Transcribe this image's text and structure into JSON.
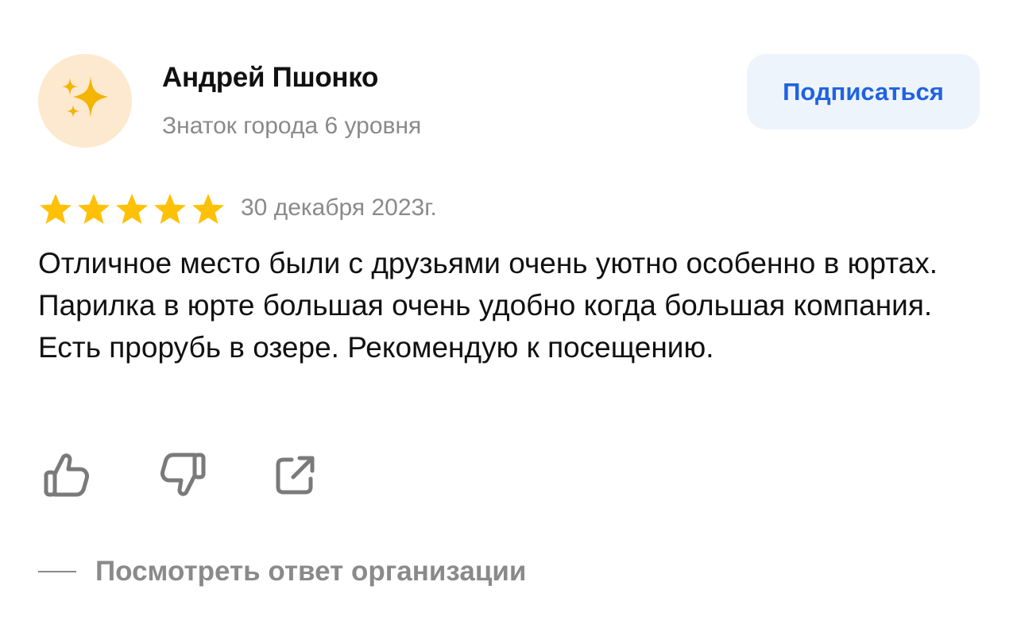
{
  "author": {
    "name": "Андрей Пшонко",
    "level": "Знаток города 6 уровня",
    "avatar_icon": "sparkles-icon"
  },
  "subscribe_label": "Подписаться",
  "review": {
    "rating": 5,
    "rating_max": 5,
    "date": "30 декабря 2023г.",
    "text": "Отличное место были с друзьями очень уютно особенно в юртах. Парилка в юрте большая очень удобно когда большая компания. Есть прорубь в озере. Рекомендую к посещению."
  },
  "actions": [
    {
      "name": "like",
      "icon": "thumbs-up-icon"
    },
    {
      "name": "dislike",
      "icon": "thumbs-down-icon"
    },
    {
      "name": "share",
      "icon": "share-icon"
    }
  ],
  "org_response_label": "Посмотреть ответ организации",
  "colors": {
    "accent": "#1f63e0",
    "button_bg": "#eef4fc",
    "star": "#ffc107",
    "muted": "#8a8a8a",
    "avatar_bg": "#fde9cf"
  }
}
